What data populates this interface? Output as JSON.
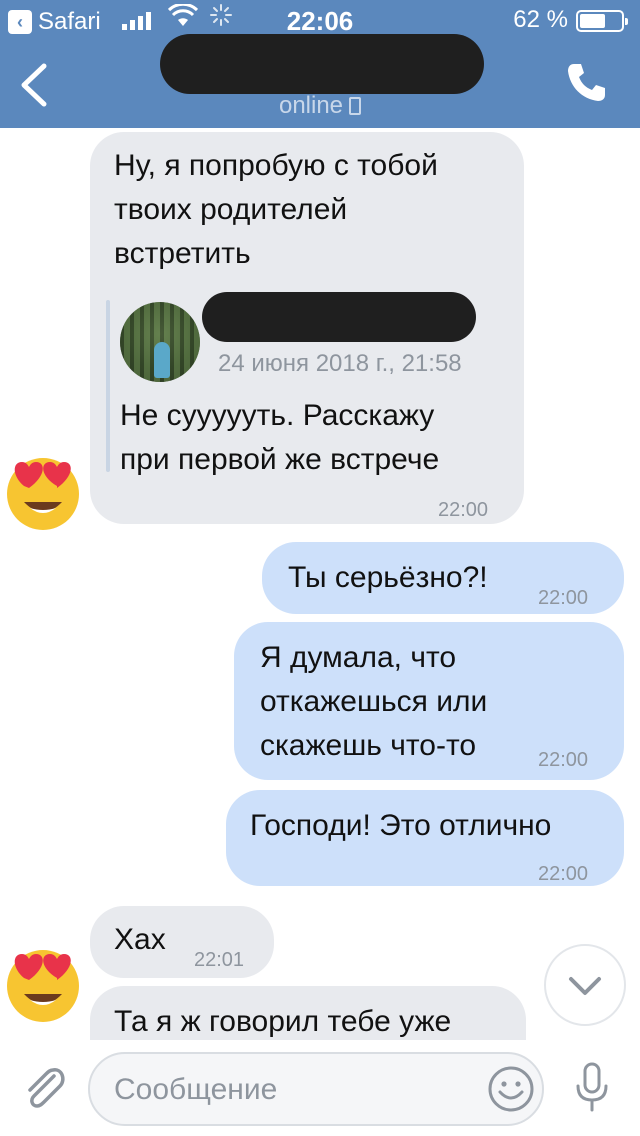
{
  "status_bar": {
    "back_app": "Safari",
    "time": "22:06",
    "battery": "62 %",
    "battery_level": 0.62
  },
  "chat_header": {
    "presence": "online"
  },
  "messages": [
    {
      "direction": "in",
      "text_lines": [
        "Ну, я попробую с тобой",
        "твоих родителей",
        "встретить"
      ],
      "forwarded": {
        "date": "24 июня 2018 г., 21:58",
        "text_lines": [
          "Не суууууть. Расскажу",
          "при первой же встрече"
        ]
      },
      "time": "22:00"
    },
    {
      "direction": "out",
      "text": "Ты серьёзно?!",
      "time": "22:00"
    },
    {
      "direction": "out",
      "text_lines": [
        "Я думала, что",
        "откажешься или",
        "скажешь что-то"
      ],
      "time": "22:00"
    },
    {
      "direction": "out",
      "text": "Господи! Это отлично",
      "time": "22:00"
    },
    {
      "direction": "in",
      "text": "Хах",
      "time": "22:01"
    },
    {
      "direction": "in",
      "text": "Та я ж говорил тебе уже"
    }
  ],
  "composer": {
    "placeholder": "Сообщение"
  },
  "icons": {
    "back": "chevron-left-icon",
    "call": "phone-icon",
    "attach": "paperclip-icon",
    "emoji": "smiley-icon",
    "mic": "microphone-icon",
    "scroll": "chevron-down-icon",
    "avatar": "heart-eyes-emoji"
  },
  "colors": {
    "header": "#5b88bd",
    "incoming_bubble": "#e8eaee",
    "outgoing_bubble": "#cde0fa"
  }
}
